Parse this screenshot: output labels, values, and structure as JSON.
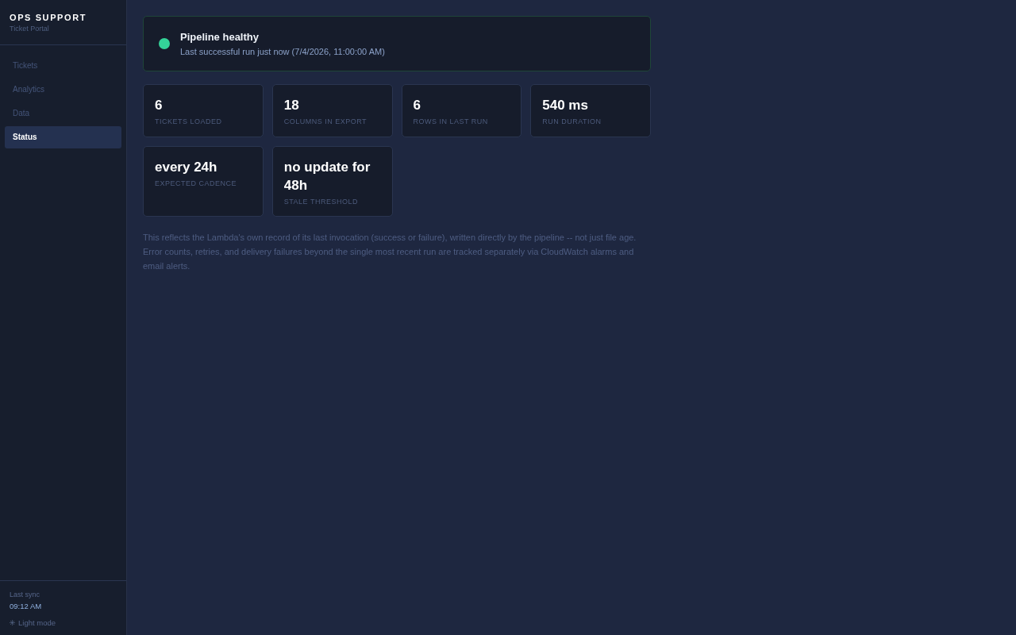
{
  "sidebar": {
    "brand": {
      "title": "OPS SUPPORT",
      "subtitle": "Ticket Portal"
    },
    "items": [
      {
        "label": "Tickets",
        "selected": false
      },
      {
        "label": "Analytics",
        "selected": false
      },
      {
        "label": "Data",
        "selected": false
      },
      {
        "label": "Status",
        "selected": true
      }
    ],
    "footer": {
      "sync_label": "Last sync",
      "sync_time": "09:12 AM",
      "theme_toggle": "Light mode"
    }
  },
  "status": {
    "healthy": true,
    "title": "Pipeline healthy",
    "detail": "Last successful run just now (7/4/2026, 11:00:00 AM)"
  },
  "stats": [
    {
      "value": "6",
      "label": "TICKETS LOADED"
    },
    {
      "value": "18",
      "label": "COLUMNS IN EXPORT"
    },
    {
      "value": "6",
      "label": "ROWS IN LAST RUN"
    },
    {
      "value": "540 ms",
      "label": "RUN DURATION"
    },
    {
      "value": "every 24h",
      "label": "EXPECTED CADENCE"
    },
    {
      "value": "no update for 48h",
      "label": "STALE THRESHOLD"
    }
  ],
  "note": "This reflects the Lambda's own record of its last invocation (success or failure), written directly by the pipeline -- not just file age. Error counts, retries, and delivery failures beyond the single most recent run are tracked separately via CloudWatch alarms and email alerts."
}
